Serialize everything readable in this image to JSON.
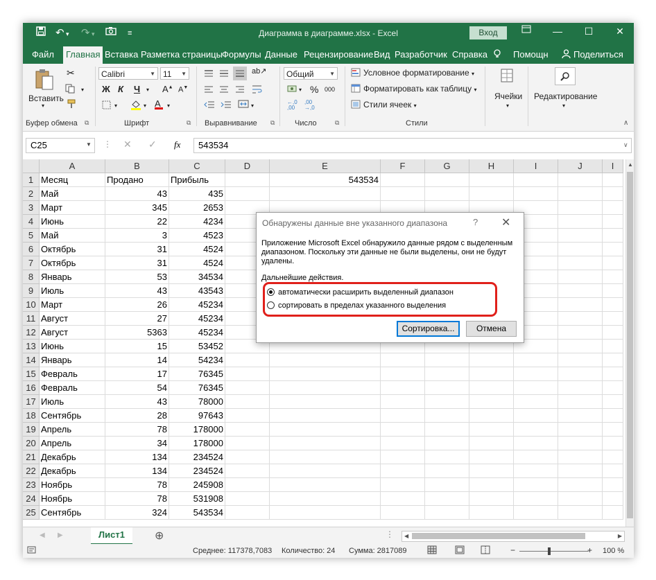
{
  "window": {
    "title": "Диаграмма в диаграмме.xlsx  -  Excel",
    "signin": "Вход",
    "minimize": "—",
    "restore": "☐",
    "close": "✕"
  },
  "tabs": [
    "Файл",
    "Главная",
    "Вставка",
    "Разметка страницы",
    "Формулы",
    "Данные",
    "Рецензирование",
    "Вид",
    "Разработчик",
    "Справка",
    "Помощн",
    "Поделиться"
  ],
  "ribbon": {
    "paste": "Вставить",
    "clipboard_label": "Буфер обмена",
    "font_name": "Calibri",
    "font_size": "11",
    "bold": "Ж",
    "italic": "К",
    "underline": "Ч",
    "font_label": "Шрифт",
    "align_label": "Выравнивание",
    "number_format": "Общий",
    "percent": "%",
    "thousands": "000",
    "number_label": "Число",
    "cond_format": "Условное форматирование",
    "format_table": "Форматировать как таблицу",
    "cell_styles": "Стили ячеек",
    "styles_label": "Стили",
    "cells": "Ячейки",
    "editing": "Редактирование"
  },
  "formula_bar": {
    "name_box": "C25",
    "fx": "fx",
    "value": "543534"
  },
  "grid": {
    "columns": [
      "A",
      "B",
      "C",
      "D",
      "E",
      "F",
      "G",
      "H",
      "I",
      "J",
      "I"
    ],
    "rows": [
      {
        "n": "1",
        "a": "Месяц",
        "b": "Продано",
        "c": "Прибыль",
        "e": "543534"
      },
      {
        "n": "2",
        "a": "Май",
        "b": "43",
        "c": "435"
      },
      {
        "n": "3",
        "a": "Март",
        "b": "345",
        "c": "2653"
      },
      {
        "n": "4",
        "a": "Июнь",
        "b": "22",
        "c": "4234"
      },
      {
        "n": "5",
        "a": "Май",
        "b": "3",
        "c": "4523"
      },
      {
        "n": "6",
        "a": "Октябрь",
        "b": "31",
        "c": "4524"
      },
      {
        "n": "7",
        "a": "Октябрь",
        "b": "31",
        "c": "4524"
      },
      {
        "n": "8",
        "a": "Январь",
        "b": "53",
        "c": "34534"
      },
      {
        "n": "9",
        "a": "Июль",
        "b": "43",
        "c": "43543"
      },
      {
        "n": "10",
        "a": "Март",
        "b": "26",
        "c": "45234"
      },
      {
        "n": "11",
        "a": "Август",
        "b": "27",
        "c": "45234"
      },
      {
        "n": "12",
        "a": "Август",
        "b": "5363",
        "c": "45234"
      },
      {
        "n": "13",
        "a": "Июнь",
        "b": "15",
        "c": "53452"
      },
      {
        "n": "14",
        "a": "Январь",
        "b": "14",
        "c": "54234"
      },
      {
        "n": "15",
        "a": "Февраль",
        "b": "17",
        "c": "76345"
      },
      {
        "n": "16",
        "a": "Февраль",
        "b": "54",
        "c": "76345"
      },
      {
        "n": "17",
        "a": "Июль",
        "b": "43",
        "c": "78000"
      },
      {
        "n": "18",
        "a": "Сентябрь",
        "b": "28",
        "c": "97643"
      },
      {
        "n": "19",
        "a": "Апрель",
        "b": "78",
        "c": "178000"
      },
      {
        "n": "20",
        "a": "Апрель",
        "b": "34",
        "c": "178000"
      },
      {
        "n": "21",
        "a": "Декабрь",
        "b": "134",
        "c": "234524"
      },
      {
        "n": "22",
        "a": "Декабрь",
        "b": "134",
        "c": "234524"
      },
      {
        "n": "23",
        "a": "Ноябрь",
        "b": "78",
        "c": "245908"
      },
      {
        "n": "24",
        "a": "Ноябрь",
        "b": "78",
        "c": "531908"
      },
      {
        "n": "25",
        "a": "Сентябрь",
        "b": "324",
        "c": "543534"
      }
    ]
  },
  "sheet": {
    "tab": "Лист1",
    "add": "⊕"
  },
  "status": {
    "average": "Среднее: 117378,7083",
    "count": "Количество: 24",
    "sum": "Сумма: 2817089",
    "zoom": "100 %"
  },
  "dialog": {
    "title": "Обнаружены данные вне указанного диапазона",
    "help": "?",
    "close": "✕",
    "body": "Приложение Microsoft Excel обнаружило данные рядом с выделенным диапазоном. Поскольку эти данные не были выделены, они не будут удалены.",
    "next_label": "Дальнейшие действия.",
    "option_expand": "автоматически расширить выделенный диапазон",
    "option_current": "сортировать в пределах указанного выделения",
    "sort_button": "Сортировка...",
    "cancel_button": "Отмена"
  },
  "colors": {
    "excel_green": "#217346",
    "highlight_red": "#e0201b"
  }
}
